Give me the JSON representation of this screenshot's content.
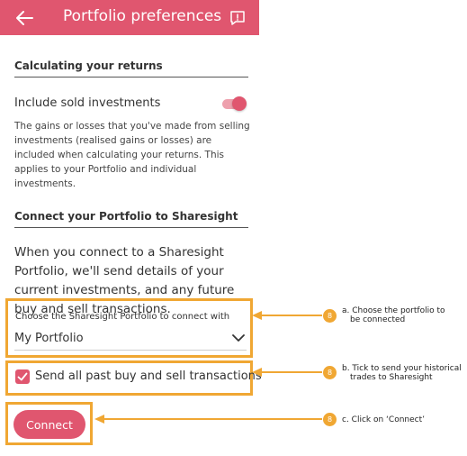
{
  "header": {
    "title": "Portfolio preferences",
    "background": "#e0566f"
  },
  "returns_section": {
    "title": "Calculating your returns",
    "toggle_label": "Include sold investments",
    "toggle_on": true,
    "description": "The gains or losses that you've made from selling investments (realised gains or losses) are included when calculating your returns. This applies to your Portfolio and individual investments."
  },
  "connect_section": {
    "title": "Connect your Portfolio to Sharesight",
    "intro": "When you connect to a Sharesight Portfolio, we'll send details of your current investments, and any future buy and sell transactions.",
    "select_label": "Choose the Sharesight Portfolio to connect with",
    "select_value": "My Portfolio",
    "checkbox_label": "Send all past buy and sell transactions",
    "checkbox_checked": true,
    "connect_button": "Connect"
  },
  "annotations": [
    {
      "badge": "8",
      "text_line1": "a. Choose the portfolio to",
      "text_line2": "be connected"
    },
    {
      "badge": "8",
      "text_line1": "b. Tick to send your historical",
      "text_line2": "trades to Sharesight"
    },
    {
      "badge": "8",
      "text_line1": "c. Click on ‘Connect’",
      "text_line2": ""
    }
  ],
  "colors": {
    "brand": "#e0566f",
    "annotation": "#f0a733"
  },
  "icons": {
    "back": "arrow-left-icon",
    "feedback": "feedback-icon",
    "dropdown": "chevron-down-icon",
    "check": "check-icon"
  }
}
